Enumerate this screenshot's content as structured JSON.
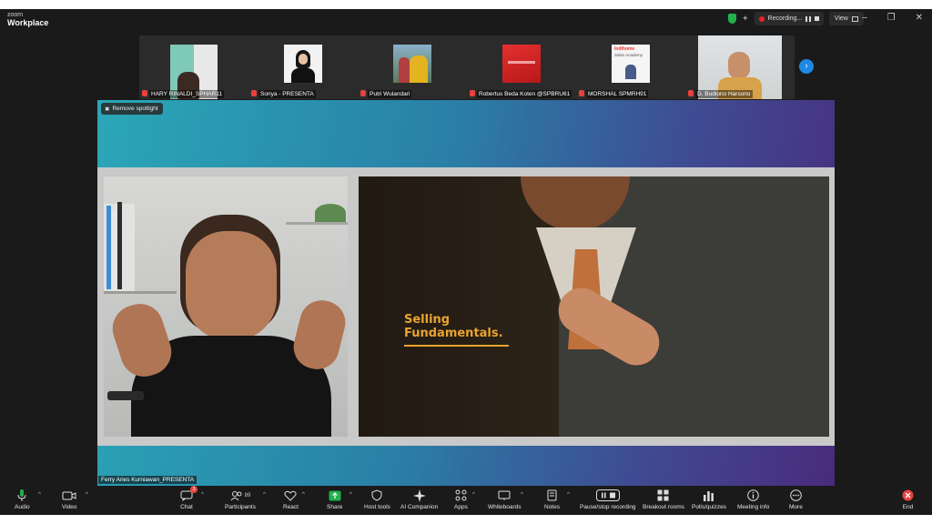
{
  "app": {
    "brand_line1": "zoom",
    "brand_line2": "Workplace"
  },
  "titlebar": {
    "recording_label": "Recording...",
    "view_label": "View",
    "minimize": "–",
    "restore": "❐",
    "close": "✕"
  },
  "participants": [
    {
      "name": "HARY RINALDI_SPHAR11"
    },
    {
      "name": "Sonya - PRESENTA"
    },
    {
      "name": "Putri Wulandari"
    },
    {
      "name": "Robertus Beda Koten @SPBRU61"
    },
    {
      "name": "MORSHAL SPMRH91"
    },
    {
      "name": "D. Budiono Harsono"
    }
  ],
  "thumb_texts": {
    "sales_academy_top": "Indihome",
    "sales_academy_bottom": "Sales Academy"
  },
  "stage": {
    "remove_spotlight": "Remove spotlight",
    "speaker_name": "Ferry Aries Kurniawan_PRESENTA",
    "slide_title_line1": "Selling",
    "slide_title_line2": "Fundamentals."
  },
  "toolbar": {
    "audio": "Audio",
    "video": "Video",
    "chat": "Chat",
    "chat_badge": "3",
    "participants": "Participants",
    "participants_count": "89",
    "react": "React",
    "share": "Share",
    "host_tools": "Host tools",
    "ai_companion": "AI Companion",
    "apps": "Apps",
    "whiteboards": "Whiteboards",
    "notes": "Notes",
    "pause_recording": "Pause/stop recording",
    "breakout_rooms": "Breakout rooms",
    "polls": "Polls/quizzes",
    "meeting_info": "Meeting info",
    "more": "More",
    "end": "End"
  },
  "colors": {
    "accent_blue": "#1e88e5",
    "recording_red": "#e8413d",
    "share_green": "#22b14c",
    "slide_title": "#e9a42f"
  }
}
